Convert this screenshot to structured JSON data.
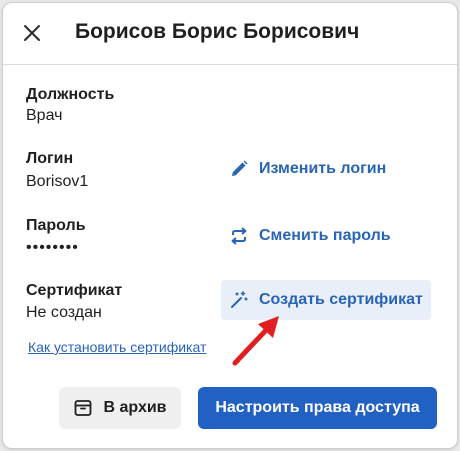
{
  "dialog": {
    "title": "Борисов Борис Борисович",
    "close_icon": "close-icon"
  },
  "fields": {
    "position": {
      "label": "Должность",
      "value": "Врач"
    },
    "login": {
      "label": "Логин",
      "value": "Borisov1"
    },
    "password": {
      "label": "Пароль",
      "value": "••••••••"
    },
    "certificate": {
      "label": "Сертификат",
      "value": "Не создан"
    }
  },
  "actions": {
    "change_login": {
      "label": "Изменить логин",
      "icon": "pencil-icon"
    },
    "change_password": {
      "label": "Сменить пароль",
      "icon": "swap-arrows-icon"
    },
    "create_certificate": {
      "label": "Создать сертификат",
      "icon": "magic-wand-icon"
    }
  },
  "help_link": {
    "label": "Как установить сертификат"
  },
  "footer": {
    "archive_label": "В архив",
    "archive_icon": "archive-box-icon",
    "access_label": "Настроить права доступа"
  },
  "colors": {
    "accent": "#2161c4",
    "link": "#2a64b7",
    "highlight_bg": "#e8eff8",
    "annotation_arrow": "#e02020"
  }
}
